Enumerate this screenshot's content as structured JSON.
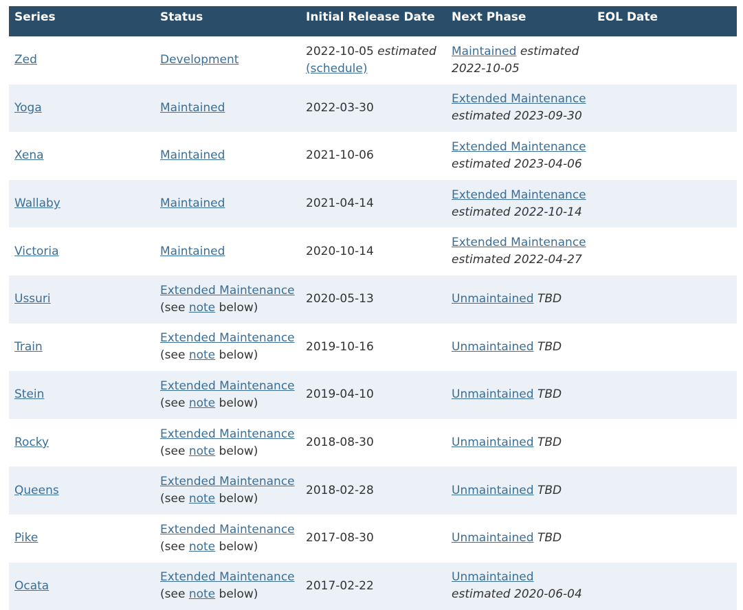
{
  "table": {
    "headers": {
      "series": "Series",
      "status": "Status",
      "initial_release_date": "Initial Release Date",
      "next_phase": "Next Phase",
      "eol_date": "EOL Date"
    },
    "rows": [
      {
        "series": "Zed",
        "status": "Development",
        "date": "2022-10-05",
        "date_estimated": "estimated",
        "date_schedule_link": "(schedule)",
        "next_phase": "Maintained",
        "next_estimate": "estimated 2022-10-05"
      },
      {
        "series": "Yoga",
        "status": "Maintained",
        "date": "2022-03-30",
        "next_phase": "Extended Maintenance",
        "next_estimate": "estimated 2023-09-30"
      },
      {
        "series": "Xena",
        "status": "Maintained",
        "date": "2021-10-06",
        "next_phase": "Extended Maintenance",
        "next_estimate": "estimated 2023-04-06"
      },
      {
        "series": "Wallaby",
        "status": "Maintained",
        "date": "2021-04-14",
        "next_phase": "Extended Maintenance",
        "next_estimate": "estimated 2022-10-14"
      },
      {
        "series": "Victoria",
        "status": "Maintained",
        "date": "2020-10-14",
        "next_phase": "Extended Maintenance",
        "next_estimate": "estimated 2022-04-27"
      },
      {
        "series": "Ussuri",
        "status": "Extended Maintenance",
        "status_note_prefix": "(see ",
        "status_note_link": "note",
        "status_note_suffix": " below)",
        "date": "2020-05-13",
        "next_phase": "Unmaintained",
        "next_estimate": "TBD"
      },
      {
        "series": "Train",
        "status": "Extended Maintenance",
        "status_note_prefix": "(see ",
        "status_note_link": "note",
        "status_note_suffix": " below)",
        "date": "2019-10-16",
        "next_phase": "Unmaintained",
        "next_estimate": "TBD"
      },
      {
        "series": "Stein",
        "status": "Extended Maintenance",
        "status_note_prefix": "(see ",
        "status_note_link": "note",
        "status_note_suffix": " below)",
        "date": "2019-04-10",
        "next_phase": "Unmaintained",
        "next_estimate": "TBD"
      },
      {
        "series": "Rocky",
        "status": "Extended Maintenance",
        "status_note_prefix": "(see ",
        "status_note_link": "note",
        "status_note_suffix": " below)",
        "date": "2018-08-30",
        "next_phase": "Unmaintained",
        "next_estimate": "TBD"
      },
      {
        "series": "Queens",
        "status": "Extended Maintenance",
        "status_note_prefix": "(see ",
        "status_note_link": "note",
        "status_note_suffix": " below)",
        "date": "2018-02-28",
        "next_phase": "Unmaintained",
        "next_estimate": "TBD"
      },
      {
        "series": "Pike",
        "status": "Extended Maintenance",
        "status_note_prefix": "(see ",
        "status_note_link": "note",
        "status_note_suffix": " below)",
        "date": "2017-08-30",
        "next_phase": "Unmaintained",
        "next_estimate": "TBD"
      },
      {
        "series": "Ocata",
        "status": "Extended Maintenance",
        "status_note_prefix": "(see ",
        "status_note_link": "note",
        "status_note_suffix": " below)",
        "date": "2017-02-22",
        "next_phase": "Unmaintained",
        "next_estimate": "estimated 2020-06-04"
      }
    ]
  },
  "colors": {
    "header_bg": "#2a4d69",
    "link": "#3a6e97",
    "alt_row_bg": "#ebf1f6",
    "text": "#333333"
  }
}
